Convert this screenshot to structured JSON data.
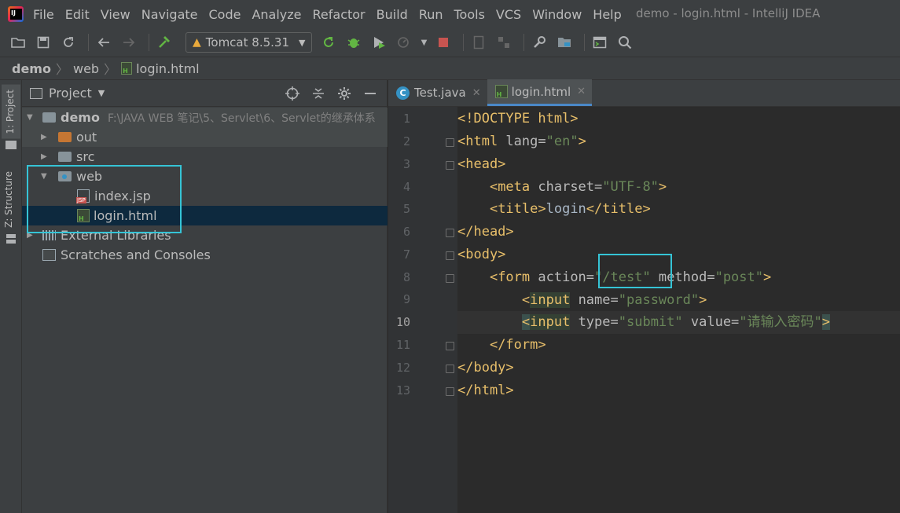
{
  "window": {
    "title": "demo - login.html - IntelliJ IDEA"
  },
  "menu": [
    "File",
    "Edit",
    "View",
    "Navigate",
    "Code",
    "Analyze",
    "Refactor",
    "Build",
    "Run",
    "Tools",
    "VCS",
    "Window",
    "Help"
  ],
  "toolbar": {
    "run_config": "Tomcat 8.5.31"
  },
  "breadcrumb": {
    "project": "demo",
    "folder": "web",
    "file": "login.html"
  },
  "left_strip": {
    "project_tab": "1: Project",
    "structure_tab": "Z: Structure"
  },
  "project_panel": {
    "title": "Project",
    "root": {
      "name": "demo",
      "path": "F:\\JAVA WEB 笔记\\5、Servlet\\6、Servlet的继承体系"
    },
    "items": [
      {
        "name": "out"
      },
      {
        "name": "src"
      },
      {
        "name": "web"
      },
      {
        "name": "index.jsp"
      },
      {
        "name": "login.html"
      },
      {
        "name": "External Libraries"
      },
      {
        "name": "Scratches and Consoles"
      }
    ]
  },
  "editor": {
    "tabs": [
      {
        "label": "Test.java"
      },
      {
        "label": "login.html"
      }
    ],
    "line_numbers": [
      "1",
      "2",
      "3",
      "4",
      "5",
      "6",
      "7",
      "8",
      "9",
      "10",
      "11",
      "12",
      "13"
    ],
    "code": {
      "l1": "<!DOCTYPE html>",
      "l2_tag": "<html ",
      "l2_attr": "lang=",
      "l2_val": "\"en\"",
      "l2_end": ">",
      "l3": "<head>",
      "l4_tag": "<meta ",
      "l4_attr": "charset=",
      "l4_val": "\"UTF-8\"",
      "l4_end": ">",
      "l5_open": "<title>",
      "l5_text": "login",
      "l5_close": "</title>",
      "l6": "</head>",
      "l7": "<body>",
      "l8_tag": "<form ",
      "l8_attr1": "action=",
      "l8_val1": "\"/test\"",
      "l8_attr2": " method=",
      "l8_val2": "\"post\"",
      "l8_end": ">",
      "l9_lt": "<",
      "l9_tag": "input",
      "l9_attr": " name=",
      "l9_val": "\"password\"",
      "l9_end": ">",
      "l10_lt": "<",
      "l10_tag": "input",
      "l10_attr1": " type=",
      "l10_val1": "\"submit\"",
      "l10_attr2": " value=",
      "l10_val2": "\"请输入密码\"",
      "l10_end": ">",
      "l11": "</form>",
      "l12": "</body>",
      "l13": "</html>"
    }
  }
}
